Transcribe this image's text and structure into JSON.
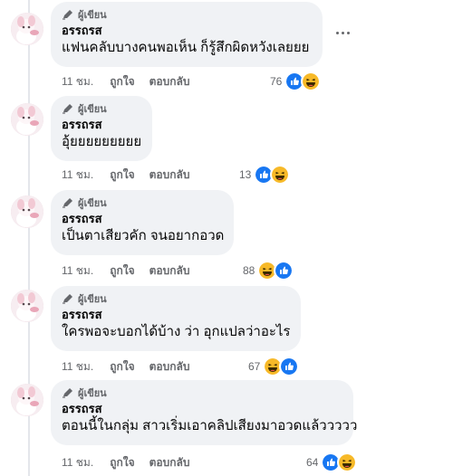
{
  "comments": [
    {
      "role": "ผู้เขียน",
      "author": "อรรถรส",
      "text": "แฟนคลับบางคนพอเห็น ก็รู้สึกผิดหวังเลยยย",
      "time": "11 ชม.",
      "like_label": "ถูกใจ",
      "reply_label": "ตอบกลับ",
      "reaction_count": "76",
      "reactions": [
        "like-icon",
        "haha-icon"
      ]
    },
    {
      "role": "ผู้เขียน",
      "author": "อรรถรส",
      "text": "อุ้ยยยยยยยยย",
      "time": "11 ชม.",
      "like_label": "ถูกใจ",
      "reply_label": "ตอบกลับ",
      "reaction_count": "13",
      "reactions": [
        "like-icon",
        "haha-icon"
      ]
    },
    {
      "role": "ผู้เขียน",
      "author": "อรรถรส",
      "text": "เป็นตาเสียวคัก จนอยากอวด",
      "time": "11 ชม.",
      "like_label": "ถูกใจ",
      "reply_label": "ตอบกลับ",
      "reaction_count": "88",
      "reactions": [
        "haha-icon",
        "like-icon"
      ]
    },
    {
      "role": "ผู้เขียน",
      "author": "อรรถรส",
      "text": "ใครพอจะบอกได้บ้าง ว่า อุกแปลว่าอะไร",
      "time": "11 ชม.",
      "like_label": "ถูกใจ",
      "reply_label": "ตอบกลับ",
      "reaction_count": "67",
      "reactions": [
        "haha-icon",
        "like-icon"
      ]
    },
    {
      "role": "ผู้เขียน",
      "author": "อรรถรส",
      "text": "ตอนนี้ในกลุ่ม สาวเริ่มเอาคลิปเสียงมาอวดแล้ววววว",
      "time": "11 ชม.",
      "like_label": "ถูกใจ",
      "reply_label": "ตอบกลับ",
      "reaction_count": "64",
      "reactions": [
        "like-icon",
        "haha-icon"
      ]
    }
  ],
  "colors": {
    "bubble": "#f0f2f5",
    "meta_text": "#65676b",
    "like_blue": "#1877f2",
    "haha_yellow": "#f7b928"
  }
}
